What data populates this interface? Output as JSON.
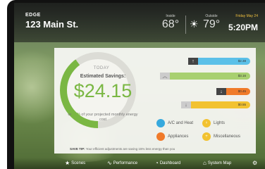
{
  "header": {
    "brand": "EDGE",
    "address": "123 Main St.",
    "inside_label": "Inside",
    "inside_temp": "68°",
    "outside_label": "Outside",
    "outside_temp": "79°",
    "date": "Friday May 24",
    "time": "5:20PM"
  },
  "savings": {
    "today_label": "TODAY",
    "title": "Estimated Savings:",
    "amount": "$24.15",
    "pct_prefix": "or ",
    "pct_value": "40%",
    "pct_suffix": " of your projected monthly energy cost",
    "ring_fill_percent": 40,
    "ring_color": "#7ab743"
  },
  "bars": [
    {
      "direction_icon": "up-arrow-icon",
      "glyph": "↑",
      "value": "$2.38",
      "color": "#5bc0e8"
    },
    {
      "direction_icon": "up-chevron-icon",
      "glyph": "︿",
      "value": "$3.16",
      "color": "#a8d070"
    },
    {
      "direction_icon": "down-arrow-icon",
      "glyph": "↓",
      "value": "$0.45",
      "color": "#f07a2a"
    },
    {
      "direction_icon": "down-arrow-icon",
      "glyph": "↓",
      "value": "$0.55",
      "color": "#f2c230"
    }
  ],
  "legend": [
    {
      "label": "A/C and Heat",
      "color": "#36a9dd",
      "icon": "snowflake-icon",
      "glyph": ""
    },
    {
      "label": "Lights",
      "color": "#f2c230",
      "icon": "bulb-icon",
      "glyph": "♀"
    },
    {
      "label": "Appliances",
      "color": "#f07a2a",
      "icon": "appliance-icon",
      "glyph": ""
    },
    {
      "label": "Miscellaneous",
      "color": "#f2c230",
      "icon": "misc-icon",
      "glyph": "+"
    }
  ],
  "tip": {
    "label": "SAVE TIP:",
    "text": "Your efficient adjustments are saving 15% less energy than you"
  },
  "nav": [
    {
      "label": "Scenes",
      "glyph": "★"
    },
    {
      "label": "Performance",
      "glyph": "∿"
    },
    {
      "label": "Dashboard",
      "glyph": "◔"
    },
    {
      "label": "System Map",
      "glyph": "⌂"
    }
  ],
  "colors": {
    "accent_green": "#7ab743",
    "date_gold": "#f0c040"
  }
}
